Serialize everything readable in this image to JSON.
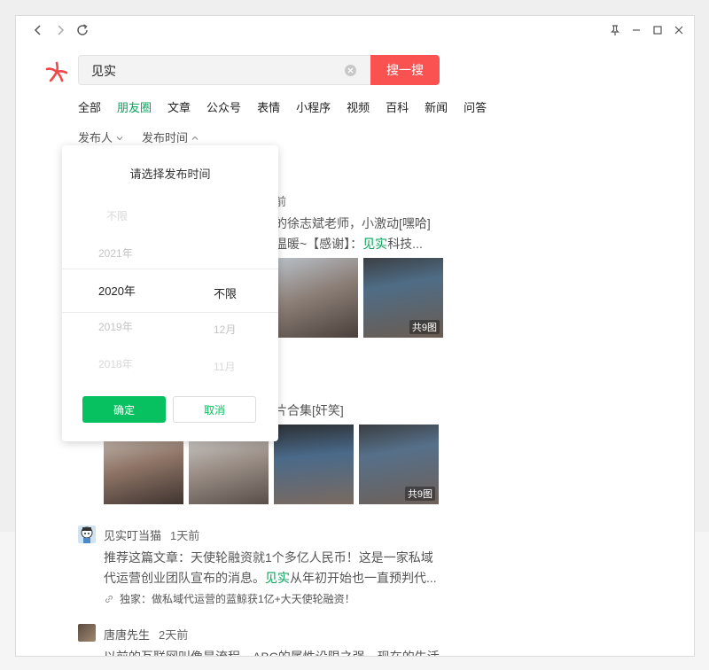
{
  "search": {
    "query": "见实",
    "button_label": "搜一搜"
  },
  "tabs": [
    "全部",
    "朋友圈",
    "文章",
    "公众号",
    "表情",
    "小程序",
    "视频",
    "百科",
    "新闻",
    "问答"
  ],
  "active_tab_index": 1,
  "filters": {
    "publisher": "发布人",
    "publish_time": "发布时间"
  },
  "picker": {
    "title": "请选择发布时间",
    "years": [
      "不限",
      "2021年",
      "2020年",
      "2019年",
      "2018年"
    ],
    "months": [
      "不限",
      "12月",
      "11月"
    ],
    "selected_year": "2020年",
    "selected_month": "不限",
    "confirm_label": "确定",
    "cancel_label": "取消"
  },
  "results": [
    {
      "time_fragment": "前",
      "line1": "的徐志斌老师，小激动[嘿哈]",
      "line2_pre": "温暖~【感谢】：",
      "line2_hl": "见实",
      "line2_post": "科技...",
      "photo_count": "共9图"
    },
    {
      "line1": "片合集[奸笑]",
      "photo_count": "共9图"
    },
    {
      "author": "见实叮当猫",
      "time": "1天前",
      "line1": "推荐这篇文章：天使轮融资就1个多亿人民币！这是一家私域",
      "line2_pre": "代运营创业团队宣布的消息。",
      "line2_hl": "见实",
      "line2_post": "从年初开始也一直预判代...",
      "link_title": "独家：做私域代运营的蓝鲸获1亿+大天使轮融资！"
    },
    {
      "author": "唐唐先生",
      "time": "2天前",
      "line1": "以前的互联网叫像是流程，ABC的属性设限之强，现在的生活"
    }
  ]
}
